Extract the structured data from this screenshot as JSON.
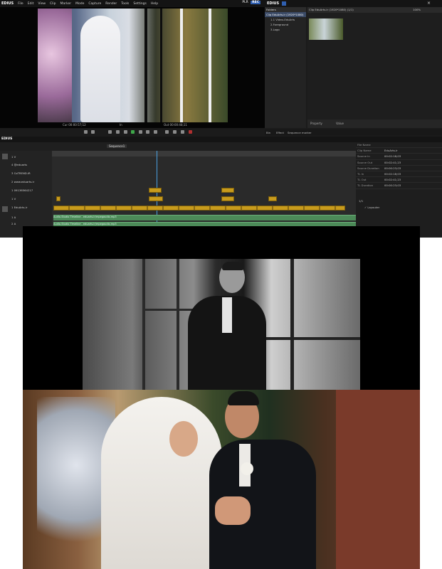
{
  "app": {
    "logo": "EDIUS",
    "menu": [
      "File",
      "Edit",
      "View",
      "Clip",
      "Marker",
      "Mode",
      "Capture",
      "Render",
      "Tools",
      "Settings",
      "Help"
    ],
    "plr_label": "PLR",
    "rec_label": "REC"
  },
  "player": {
    "cur_label": "Cur",
    "cur_value": "00:00:57;12",
    "in_label": "In",
    "out_label": "Out",
    "out_value": "00:00:48;11"
  },
  "bin": {
    "folders_header": "Folders",
    "folders": [
      "Clip EduArts.ir (1920*1080)",
      "1.1 Video-EduArts",
      "2.Foreground",
      "3.Logo"
    ],
    "clip_header": "Clip EduArts.ir (1920*1080) (1/1)",
    "zoom": "100%",
    "props_tab": "Property",
    "value_tab": "Value",
    "bottom_tabs": [
      "Bin",
      "Effect",
      "Sequence marker"
    ]
  },
  "timeline": {
    "header_label": "EDIUS",
    "sequence_tab": "Sequence1",
    "tracks": [
      "1 V",
      "4 @eduarts",
      "3 CoTREND.iR",
      "2 www.eduarts.ir",
      "1 09136564217",
      "1 V",
      "1 EduArts.ir",
      "1 A",
      "2 A"
    ],
    "audio_clips": [
      "Audio-Studio Timeline - eduarts.ir/mpegaudio.mp3",
      "Audio-Studio Timeline - eduarts.ir/mpegaudio.mp3"
    ]
  },
  "properties": {
    "rows": [
      {
        "label": "File Name",
        "value": ""
      },
      {
        "label": "Clip Name",
        "value": "EduArts.ir"
      },
      {
        "label": "Source In",
        "value": "00:02:18;03"
      },
      {
        "label": "Source Out",
        "value": "00:02:41;23"
      },
      {
        "label": "Source Duration",
        "value": "00:00:23;03"
      },
      {
        "label": "TL In",
        "value": "00:02:18;03"
      },
      {
        "label": "TL Out",
        "value": "00:02:41;23"
      },
      {
        "label": "TL Duration",
        "value": "00:00:23;03"
      }
    ],
    "layouter_label": "Layouter",
    "counter": "1/1"
  }
}
